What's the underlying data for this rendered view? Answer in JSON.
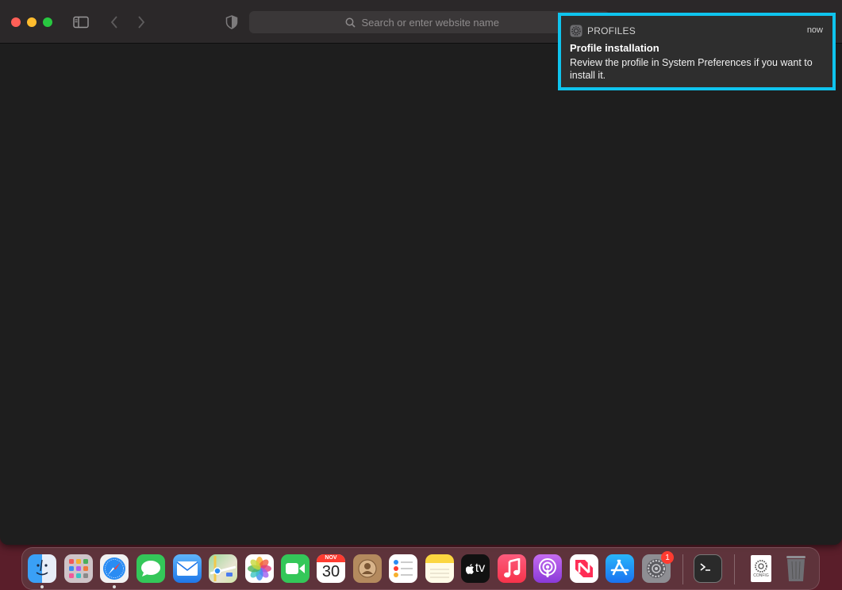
{
  "browser": {
    "search_placeholder": "Search or enter website name"
  },
  "notification": {
    "app_name": "PROFILES",
    "time": "now",
    "title": "Profile installation",
    "body": "Review the profile in System Preferences if you want to install it."
  },
  "dock": {
    "calendar_month": "NOV",
    "calendar_day": "30",
    "tv_label": "tv",
    "settings_badge": "1",
    "config_label": "CONFIG",
    "items": [
      "Finder",
      "Launchpad",
      "Safari",
      "Messages",
      "Mail",
      "Maps",
      "Photos",
      "FaceTime",
      "Calendar",
      "Contacts",
      "Reminders",
      "Notes",
      "TV",
      "Music",
      "Podcasts",
      "News",
      "App Store",
      "System Preferences",
      "Terminal",
      "Config Profile",
      "Trash"
    ]
  },
  "colors": {
    "highlight": "#0fc4ee",
    "window_bg": "#1e1e1e",
    "toolbar_bg": "#2b2829",
    "desktop": "#5a1e2a"
  }
}
